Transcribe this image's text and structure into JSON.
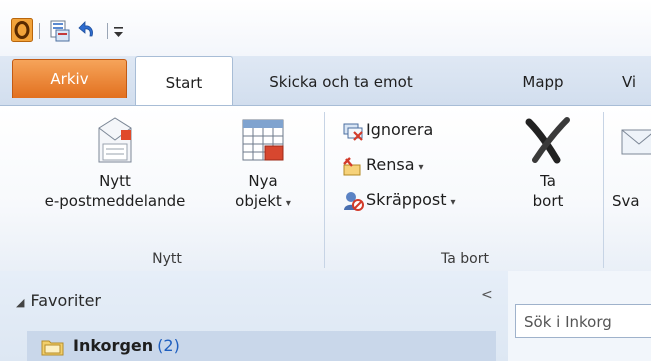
{
  "qat": {
    "icons": [
      "outlook-icon",
      "send-receive-icon",
      "undo-icon",
      "customize-icon"
    ]
  },
  "tabs": [
    {
      "label": "Arkiv",
      "active": false,
      "color": "#e2701f"
    },
    {
      "label": "Start",
      "active": true
    },
    {
      "label": "Skicka och ta emot",
      "active": false
    },
    {
      "label": "Mapp",
      "active": false
    },
    {
      "label": "Vi",
      "active": false
    }
  ],
  "ribbon": {
    "new_group": {
      "label": "Nytt",
      "new_email": {
        "line1": "Nytt",
        "line2": "e-postmeddelande"
      },
      "new_items": {
        "line1": "Nya",
        "line2": "objekt",
        "caret": "▾"
      }
    },
    "delete_group": {
      "label": "Ta bort",
      "ignore": "Ignorera",
      "clean_up": "Rensa",
      "junk": "Skräppost",
      "delete": {
        "line1": "Ta",
        "line2": "bort"
      },
      "caret": "▾"
    },
    "respond_group": {
      "reply_partial": "Sva"
    }
  },
  "nav": {
    "favorites": "Favoriter",
    "collapse": "<",
    "inbox_name": "Inkorgen",
    "inbox_count": "(2)"
  },
  "search": {
    "placeholder": "Sök i Inkorg"
  },
  "colors": {
    "accent": "#e2701f",
    "ribbon_bg": "#f7f9fc",
    "nav_bg": "#dde7f3",
    "selected": "#c9d7ea",
    "unread": "#1f5fbf"
  }
}
